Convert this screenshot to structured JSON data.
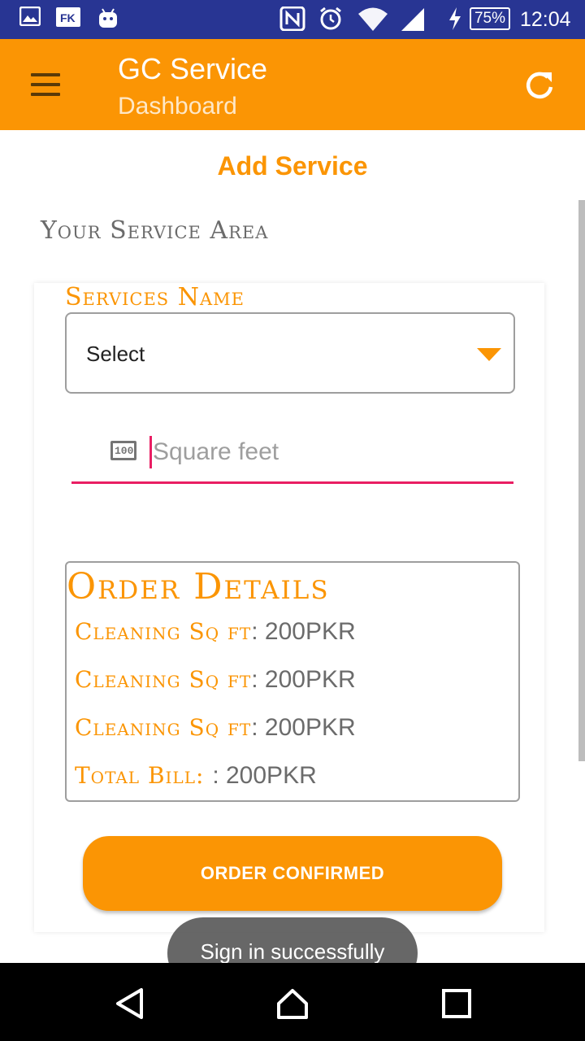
{
  "status_bar": {
    "left_icons": [
      "gallery-icon",
      "fk-icon",
      "android-icon"
    ],
    "right_icons": [
      "nfc-icon",
      "alarm-icon",
      "wifi-icon",
      "signal-icon",
      "charging-icon"
    ],
    "fk_label": "FK",
    "battery": "75%",
    "time": "12:04"
  },
  "app_bar": {
    "title": "GC Service",
    "subtitle": "Dashboard",
    "menu_icon": "hamburger-menu-icon",
    "refresh_icon": "refresh-icon"
  },
  "page": {
    "heading": "Add Service",
    "section_label": "Your Service Area",
    "services_label": "Services Name",
    "select_value": "Select",
    "sqft_placeholder": "Square feet",
    "sqft_icon_label": "100"
  },
  "order": {
    "title": "Order Details",
    "lines": [
      {
        "label": "Cleaning Sq ft",
        "sep": ": ",
        "value": "200PKR"
      },
      {
        "label": "Cleaning Sq ft",
        "sep": ": ",
        "value": "200PKR"
      },
      {
        "label": "Cleaning Sq ft",
        "sep": ": ",
        "value": "200PKR"
      },
      {
        "label": "Total Bill: ",
        "sep": ": ",
        "value": "200PKR"
      }
    ]
  },
  "confirm_button": "ORDER CONFIRMED",
  "toast": "Sign in successfully",
  "nav_bar": {
    "back_icon": "back-triangle-icon",
    "home_icon": "home-icon",
    "recents_icon": "recents-square-icon"
  },
  "colors": {
    "accent": "#fb9504",
    "status_bar": "#283593",
    "input_underline": "#e91e63"
  }
}
